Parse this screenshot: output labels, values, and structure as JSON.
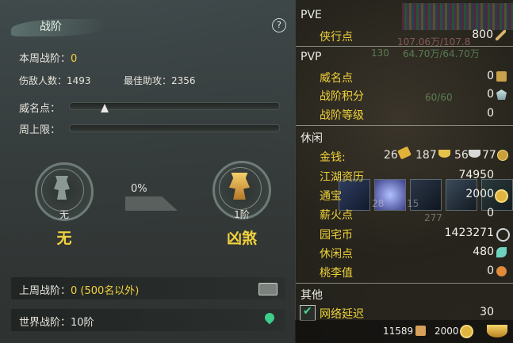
{
  "left": {
    "title": "战阶",
    "help": "?",
    "weekly_label": "本周战阶：",
    "weekly_value": "0",
    "injured_label": "伤敌人数：",
    "injured_value": "1493",
    "best_assist_label": "最佳助攻：",
    "best_assist_value": "2356",
    "prestige_label": "威名点：",
    "weekly_cap_label": "周上限：",
    "progress_percent": "0%",
    "current_rank_small": "无",
    "current_rank_name": "无",
    "next_rank_small": "1阶",
    "next_rank_name": "凶煞",
    "last_week_label": "上周战阶：",
    "last_week_value": "0 (500名以外)",
    "world_label": "世界战阶：",
    "world_value": "10阶"
  },
  "right": {
    "sections": {
      "pve": "PVE",
      "pvp": "PVP",
      "leisure": "休闲",
      "other": "其他"
    },
    "pve_items": [
      {
        "label": "侠行点",
        "value": "800"
      }
    ],
    "pvp_items": [
      {
        "label": "威名点",
        "value": "0"
      },
      {
        "label": "战阶积分",
        "value": "0"
      },
      {
        "label": "战阶等级",
        "value": "0"
      }
    ],
    "gold_label": "金钱:",
    "gold_values": [
      "26",
      "187",
      "56",
      "77"
    ],
    "leisure_items": [
      {
        "label": "江湖资历",
        "value": "74950"
      },
      {
        "label": "通宝",
        "value": "2000"
      },
      {
        "label": "薪火点",
        "value": "0"
      },
      {
        "label": "园宅币",
        "value": "1423271"
      },
      {
        "label": "休闲点",
        "value": "480"
      },
      {
        "label": "桃李值",
        "value": "0"
      }
    ],
    "other_items": [
      {
        "label": "网络延迟",
        "value": "30"
      }
    ],
    "bg_text": {
      "hp": "107.06万/107.8",
      "mp": "64.70万/64.70万",
      "level": "130",
      "energy": "60/60",
      "cnt1": "28",
      "cnt2": "15",
      "cnt3": "277"
    },
    "footer": {
      "v1": "11589",
      "v2": "2000"
    },
    "colors": {
      "accent_yellow": "#f2d23c",
      "section_text": "#eaeae4"
    }
  }
}
